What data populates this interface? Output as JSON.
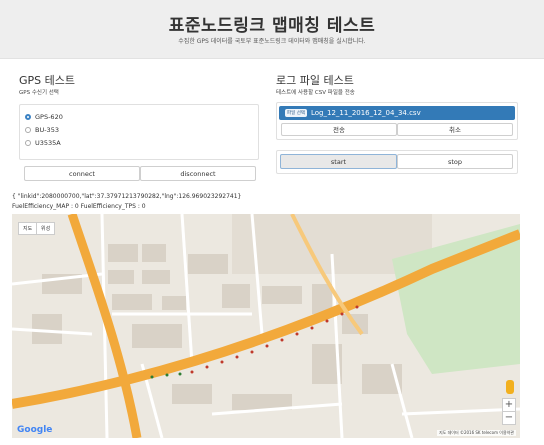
{
  "header": {
    "title": "표준노드링크 맵매칭 테스트",
    "subtitle": "수집한 GPS 데이터를 국토부 표준노드링크 데이터와 맵매칭을 실시합니다."
  },
  "gps": {
    "title": "GPS 테스트",
    "subtitle": "GPS 수신기 선택",
    "options": [
      {
        "label": "GPS-620",
        "selected": true
      },
      {
        "label": "BU-353",
        "selected": false
      },
      {
        "label": "U3535A",
        "selected": false
      }
    ],
    "connect_label": "connect",
    "disconnect_label": "disconnect"
  },
  "log": {
    "title": "로그 파일 테스트",
    "subtitle": "테스트에 사용할 CSV 파일을 전송",
    "file_badge": "파일 선택",
    "file_name": "Log_12_11_2016_12_04_34.csv",
    "send_label": "전송",
    "cancel_label": "취소",
    "start_label": "start",
    "stop_label": "stop"
  },
  "result": {
    "json_line": "{ \"linkid\":2080000700,\"lat\":37.37971213790282,\"lng\":126.969023292741}",
    "efficiency_line": "FuelEfficiency_MAP : 0 FuelEfficiency_TPS : 0"
  },
  "map": {
    "tab_map": "지도",
    "tab_satellite": "위성",
    "zoom_in": "+",
    "zoom_out": "−",
    "attribution": "지도 데이터 ©2016 SK telecom",
    "terms": "이용약관",
    "google": "Google",
    "road_color": "#f5a623",
    "route_color": "#c0392b"
  }
}
